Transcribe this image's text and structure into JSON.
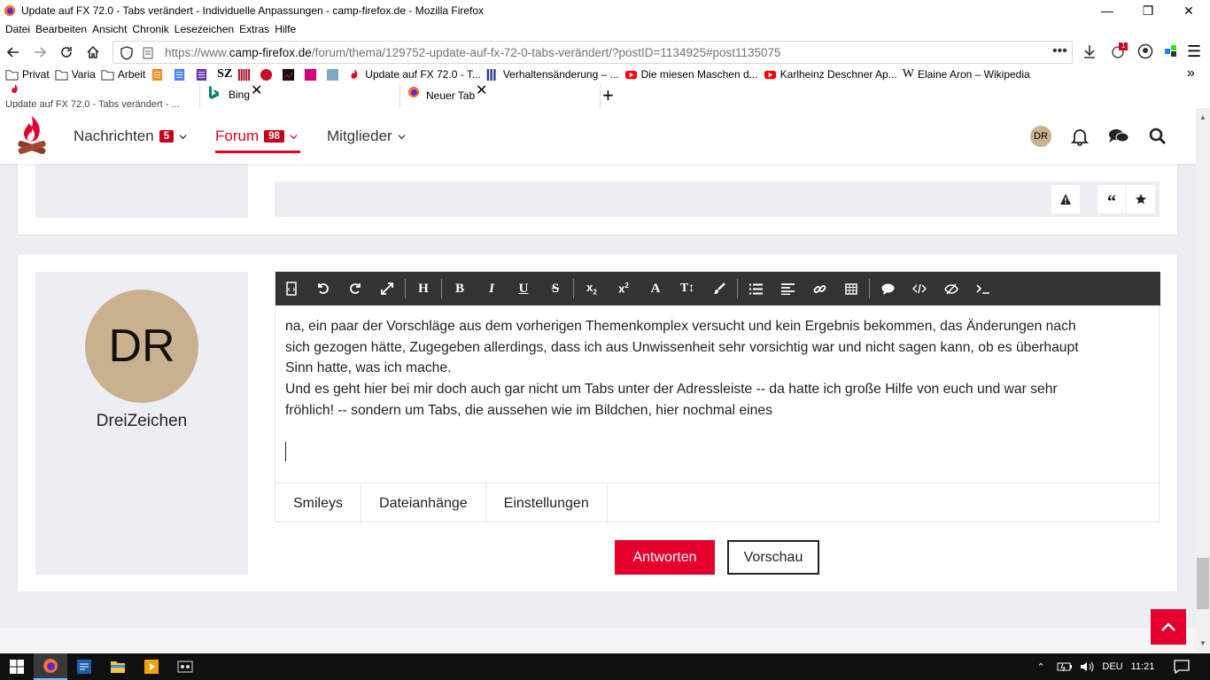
{
  "window": {
    "title": "Update auf FX 72.0 - Tabs verändert - Individuelle Anpassungen - camp-firefox.de - Mozilla Firefox"
  },
  "menu": [
    "Datei",
    "Bearbeiten",
    "Ansicht",
    "Chronik",
    "Lesezeichen",
    "Extras",
    "Hilfe"
  ],
  "urlbar": {
    "prefix": "https://www.",
    "domain": "camp-firefox.de",
    "path": "/forum/thema/129752-update-auf-fx-72-0-tabs-verändert/?postID=1134925#post1135075",
    "badge_count": "1"
  },
  "bookmarks": [
    {
      "label": "Privat",
      "icon": "folder-icon"
    },
    {
      "label": "Varia",
      "icon": "folder-icon"
    },
    {
      "label": "Arbeit",
      "icon": "folder-icon"
    },
    {
      "label": "SZ",
      "icon": "sz-icon"
    },
    {
      "label": "Update auf FX 72.0 - T...",
      "icon": "campfire-icon"
    },
    {
      "label": "Verhaltensänderung – ...",
      "icon": "library-icon"
    },
    {
      "label": "Die miesen Maschen d...",
      "icon": "youtube-icon"
    },
    {
      "label": "Karlheinz Deschner Ap...",
      "icon": "youtube-icon"
    },
    {
      "label": "Elaine Aron – Wikipedia",
      "icon": "wikipedia-icon"
    }
  ],
  "tabs": [
    {
      "label": "Update auf FX 72.0 - Tabs verändert - ...",
      "active": true
    },
    {
      "label": "Bing",
      "active": false
    },
    {
      "label": "Neuer Tab",
      "active": false
    }
  ],
  "site": {
    "nav": [
      {
        "label": "Nachrichten",
        "badge": "5"
      },
      {
        "label": "Forum",
        "badge": "98"
      },
      {
        "label": "Mitglieder",
        "badge": ""
      }
    ],
    "avatar_initials": "DR",
    "accent": "#e4002b"
  },
  "post": {
    "author_initials": "DR",
    "author_name": "DreiZeichen",
    "text_lines": [
      "na, ein paar der Vorschläge aus dem vorherigen Themenkomplex versucht und kein Ergebnis bekommen, das Änderungen nach",
      "sich gezogen hätte, Zugegeben allerdings, dass ich aus Unwissenheit sehr vorsichtig war und nicht sagen kann, ob es überhaupt",
      "Sinn hatte, was ich mache.",
      "Und es geht hier bei mir doch auch gar nicht um Tabs unter der Adressleiste -- da hatte ich große Hilfe von euch und war sehr",
      "fröhlich! -- sondern um Tabs, die aussehen wie im Bildchen, hier nochmal eines"
    ],
    "editor_tabs": [
      "Smileys",
      "Dateianhänge",
      "Einstellungen"
    ],
    "reply_label": "Antworten",
    "preview_label": "Vorschau"
  },
  "taskbar": {
    "language": "DEU",
    "time": "11:21"
  }
}
